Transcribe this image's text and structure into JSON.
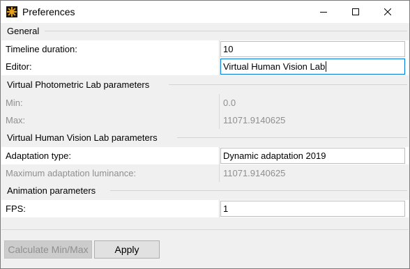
{
  "window": {
    "title": "Preferences",
    "icon": "app-sunburst-icon"
  },
  "sections": {
    "general": {
      "title": "General",
      "timeline_label": "Timeline duration:",
      "timeline_value": "10",
      "editor_label": "Editor:",
      "editor_value": "Virtual Human Vision Lab"
    },
    "photometric": {
      "title": "Virtual Photometric Lab parameters",
      "min_label": "Min:",
      "min_value": "0.0",
      "max_label": "Max:",
      "max_value": "11071.9140625"
    },
    "vision": {
      "title": "Virtual Human Vision Lab parameters",
      "adaptation_label": "Adaptation type:",
      "adaptation_value": "Dynamic adaptation 2019",
      "max_lum_label": "Maximum adaptation luminance:",
      "max_lum_value": "11071.9140625"
    },
    "animation": {
      "title": "Animation parameters",
      "fps_label": "FPS:",
      "fps_value": "1"
    }
  },
  "buttons": {
    "calculate": "Calculate Min/Max",
    "apply": "Apply"
  },
  "colors": {
    "focus_border": "#0078d7",
    "disabled_text": "#8f8f8f"
  }
}
